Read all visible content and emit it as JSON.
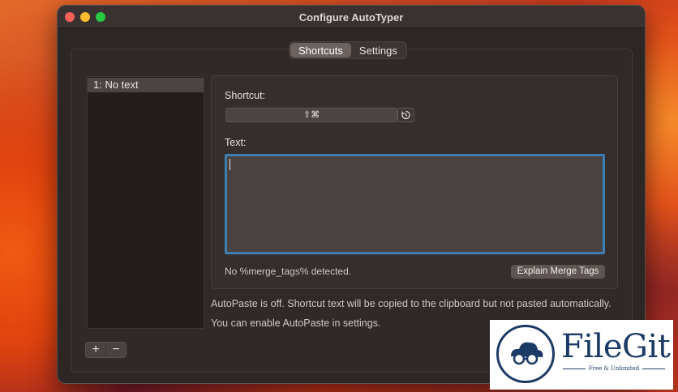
{
  "window": {
    "title": "Configure AutoTyper"
  },
  "tabs": [
    {
      "label": "Shortcuts",
      "active": true
    },
    {
      "label": "Settings",
      "active": false
    }
  ],
  "sidebar": {
    "items": [
      {
        "label": "1: No text"
      }
    ]
  },
  "sidebar_controls": {
    "add_label": "+",
    "remove_label": "−"
  },
  "shortcut": {
    "label": "Shortcut:",
    "value": "⇧⌘"
  },
  "text": {
    "label": "Text:",
    "value": ""
  },
  "merge": {
    "status": "No %merge_tags% detected.",
    "explain_button": "Explain Merge Tags"
  },
  "info": {
    "line1": "AutoPaste is off. Shortcut text will be copied to the clipboard but not pasted automatically.",
    "line2": "You can enable AutoPaste in settings."
  },
  "watermark": {
    "name": "FileGit",
    "tagline": "Free & Unlimited"
  },
  "colors": {
    "focus_ring": "#3c7fb4",
    "close": "#fe5f57",
    "minimize": "#febc2e",
    "zoom": "#28c840",
    "brand": "#1c3a66"
  }
}
